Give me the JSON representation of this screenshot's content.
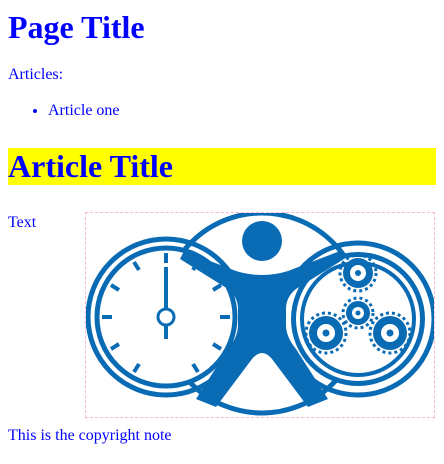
{
  "page": {
    "title": "Page Title",
    "articles_label": "Articles:",
    "articles": [
      "Article one"
    ]
  },
  "article": {
    "title": "Article Title",
    "text": "Text"
  },
  "logo": {
    "icon": "accessibility-clock-gears-logo",
    "color": "#0a6bb5"
  },
  "footer": {
    "copyright": "This is the copyright note"
  },
  "colors": {
    "text": "#0000ff",
    "highlight": "#ffff00",
    "border": "#f3b8d4"
  }
}
